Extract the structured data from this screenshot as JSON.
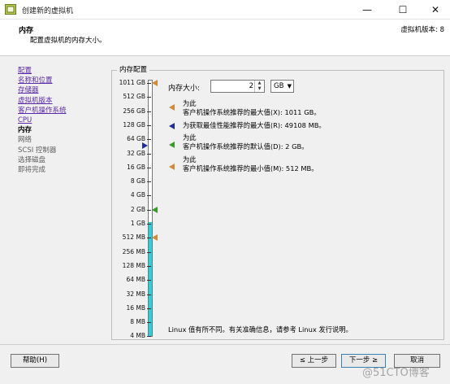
{
  "window": {
    "title": "创建新的虚拟机",
    "minimize": "—",
    "maximize": "☐",
    "close": "✕"
  },
  "header": {
    "title": "内存",
    "subtitle": "配置虚拟机的内存大小。",
    "version": "虚拟机版本: 8"
  },
  "nav": {
    "items": [
      {
        "label": "配置",
        "state": "link"
      },
      {
        "label": "名称和位置",
        "state": "link"
      },
      {
        "label": "存储器",
        "state": "link"
      },
      {
        "label": "虚拟机版本",
        "state": "link"
      },
      {
        "label": "客户机操作系统",
        "state": "link"
      },
      {
        "label": "CPU",
        "state": "link"
      },
      {
        "label": "内存",
        "state": "current"
      },
      {
        "label": "网络",
        "state": "pending"
      },
      {
        "label": "SCSI 控制器",
        "state": "pending"
      },
      {
        "label": "选择磁盘",
        "state": "pending"
      },
      {
        "label": "即将完成",
        "state": "pending"
      }
    ]
  },
  "memory": {
    "group_title": "内存配置",
    "size_label": "内存大小:",
    "value": "2",
    "unit": "GB",
    "scale_labels": [
      "1011 GB",
      "512 GB",
      "256 GB",
      "128 GB",
      "64 GB",
      "32 GB",
      "16 GB",
      "8 GB",
      "4 GB",
      "2 GB",
      "1 GB",
      "512 MB",
      "256 MB",
      "128 MB",
      "64 MB",
      "32 MB",
      "16 MB",
      "8 MB",
      "4 MB"
    ],
    "fill_level_fraction": 0.555,
    "legend": [
      {
        "line1": "为此",
        "line2": "客户机操作系统推荐的最大值(X): 1011 GB。",
        "color": "#d08a3a",
        "marker_at": "1011 GB"
      },
      {
        "line1": "",
        "line2": "为获取最佳性能推荐的最大值(R): 49108 MB。",
        "color": "#1f2f99",
        "marker_at": "49108 MB"
      },
      {
        "line1": "为此",
        "line2": "客户机操作系统推荐的默认值(D): 2 GB。",
        "color": "#3a9a2a",
        "marker_at": "2 GB"
      },
      {
        "line1": "为此",
        "line2": "客户机操作系统推荐的最小值(M): 512 MB。",
        "color": "#d08a3a",
        "marker_at": "512 MB"
      }
    ],
    "note": "Linux 值有所不同。有关准确信息，请参考 Linux 发行说明。"
  },
  "buttons": {
    "help": "帮助(H)",
    "back": "≤ 上一步",
    "next": "下一步 ≥",
    "cancel": "取消"
  },
  "watermark": "@51CTO博客",
  "colors": {
    "fill": "#22d3e0",
    "max_marker": "#d08a3a",
    "perf_marker": "#1f2f99",
    "default_marker": "#3a9a2a",
    "min_marker": "#d08a3a"
  }
}
